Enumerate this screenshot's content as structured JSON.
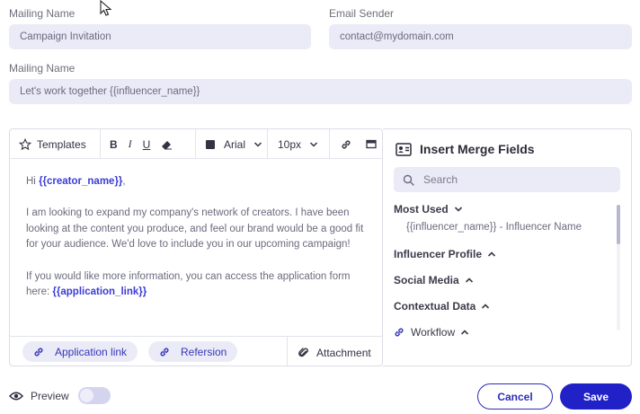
{
  "form": {
    "mailing_name_label": "Mailing Name",
    "mailing_name_value": "Campaign Invitation",
    "email_sender_label": "Email Sender",
    "email_sender_value": "contact@mydomain.com",
    "subject_label": "Mailing Name",
    "subject_value": "Let's work together {{influencer_name}}"
  },
  "toolbar": {
    "templates_label": "Templates",
    "font_value": "Arial",
    "size_value": "10px",
    "icons": [
      "star-icon",
      "bold-icon",
      "italic-icon",
      "underline-icon",
      "eraser-icon",
      "color-swatch-icon",
      "link-icon",
      "image-icon"
    ]
  },
  "editor": {
    "greeting": "Hi ",
    "greeting_merge": "{{creator_name}}",
    "greeting_end": ",",
    "paragraph1": "I am looking to expand my company's network of creators. I have been looking at the content you produce, and feel our brand would be a good fit for your audience. We'd love to include you in our upcoming campaign!",
    "paragraph2": "If you would like more information, you can access the application form here: ",
    "paragraph2_merge": "{{application_link}}"
  },
  "bottom_bar": {
    "application_link_label": "Application link",
    "referral_label": "Refersion",
    "attachment_label": "Attachment"
  },
  "merge_panel": {
    "title": "Insert Merge Fields",
    "search_placeholder": "Search",
    "sections": {
      "most_used": "Most Used",
      "most_used_item": "{{influencer_name}} - Influencer Name",
      "influencer_profile": "Influencer Profile",
      "social_media": "Social Media",
      "contextual_data": "Contextual Data",
      "workflow": "Workflow"
    }
  },
  "footer": {
    "preview_label": "Preview",
    "cancel_label": "Cancel",
    "save_label": "Save"
  },
  "colors": {
    "accent": "#2121c8",
    "field_bg": "#ebebf7",
    "merge_text": "#3b3bd6"
  }
}
